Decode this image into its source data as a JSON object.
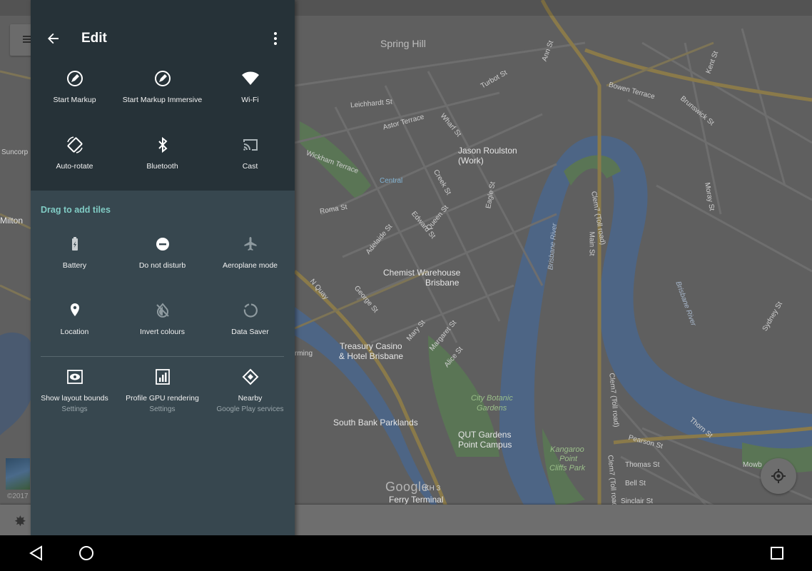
{
  "panel": {
    "title": "Edit",
    "drag_label": "Drag to add tiles",
    "active_tiles": [
      {
        "label": "Start Markup",
        "icon": "markup-icon"
      },
      {
        "label": "Start Markup Immersive",
        "icon": "markup-icon"
      },
      {
        "label": "Wi-Fi",
        "icon": "wifi-icon"
      },
      {
        "label": "Auto-rotate",
        "icon": "auto-rotate-icon"
      },
      {
        "label": "Bluetooth",
        "icon": "bluetooth-icon"
      },
      {
        "label": "Cast",
        "icon": "cast-icon"
      }
    ],
    "available_tiles": [
      {
        "label": "Battery",
        "icon": "battery-icon"
      },
      {
        "label": "Do not disturb",
        "icon": "do-not-disturb-icon"
      },
      {
        "label": "Aeroplane mode",
        "icon": "aeroplane-icon"
      },
      {
        "label": "Location",
        "icon": "location-icon"
      },
      {
        "label": "Invert colours",
        "icon": "invert-colours-icon"
      },
      {
        "label": "Data Saver",
        "icon": "data-saver-icon"
      }
    ],
    "third_party_tiles": [
      {
        "label": "Show layout bounds",
        "sub": "Settings",
        "icon": "layout-bounds-icon"
      },
      {
        "label": "Profile GPU rendering",
        "sub": "Settings",
        "icon": "gpu-rendering-icon"
      },
      {
        "label": "Nearby",
        "sub": "Google Play services",
        "icon": "nearby-icon"
      }
    ]
  },
  "map": {
    "labels": {
      "spring_hill": "Spring Hill",
      "jason_roulston": "Jason Roulston",
      "work": "(Work)",
      "central": "Central",
      "chemist_1": "Chemist Warehouse",
      "chemist_2": "Brisbane",
      "treasury_1": "Treasury Casino",
      "treasury_2": "& Hotel Brisbane",
      "botanic_1": "City Botanic",
      "botanic_2": "Gardens",
      "qut_1": "QUT Gardens",
      "qut_2": "Point Campus",
      "south_bank": "South Bank Parklands",
      "kangaroo_1": "Kangaroo",
      "kangaroo_2": "Point",
      "kangaroo_3": "Cliffs Park",
      "ferry": "Ferry Terminal",
      "milton": "Milton",
      "suncorp": "Suncorp",
      "brisbane_river_1": "Brisbane River",
      "brisbane_river_2": "Brisbane River",
      "clem7_1": "Clem7 (Toll road)",
      "clem7_2": "Clem7 (Toll road)",
      "roma_st": "Roma St",
      "wickham_terrace": "Wickham Terrace",
      "leichhardt_st": "Leichhardt St",
      "bowen_terrace": "Bowen Terrace",
      "brunswick_st": "Brunswick St",
      "adelaide_st": "Adelaide St",
      "queen_st": "Queen St",
      "george_st": "George St",
      "mary_st": "Mary St",
      "margaret_st": "Margaret St",
      "alice_st": "Alice St",
      "edward_st": "Edward St",
      "creek_st": "Creek St",
      "eagle_st": "Eagle St",
      "ann_st": "Ann St",
      "turbot_st": "Turbot St",
      "main_st": "Main St",
      "kent_st": "Kent St",
      "moray_st": "Moray St",
      "sydney_st": "Sydney St",
      "thomas_st": "Thomas St",
      "pearson_st": "Pearson St",
      "thorn_st": "Thorn St",
      "bell_st": "Bell St",
      "sinclair_st": "Sinclair St",
      "n_quay": "N Quay",
      "astor_terrace": "Astor Terrace",
      "wharf_st": "Wharf St",
      "mowb": "Mowb",
      "ming": "rming",
      "kh3": "KH 3",
      "copyright": "©2017"
    },
    "google": "Google"
  }
}
